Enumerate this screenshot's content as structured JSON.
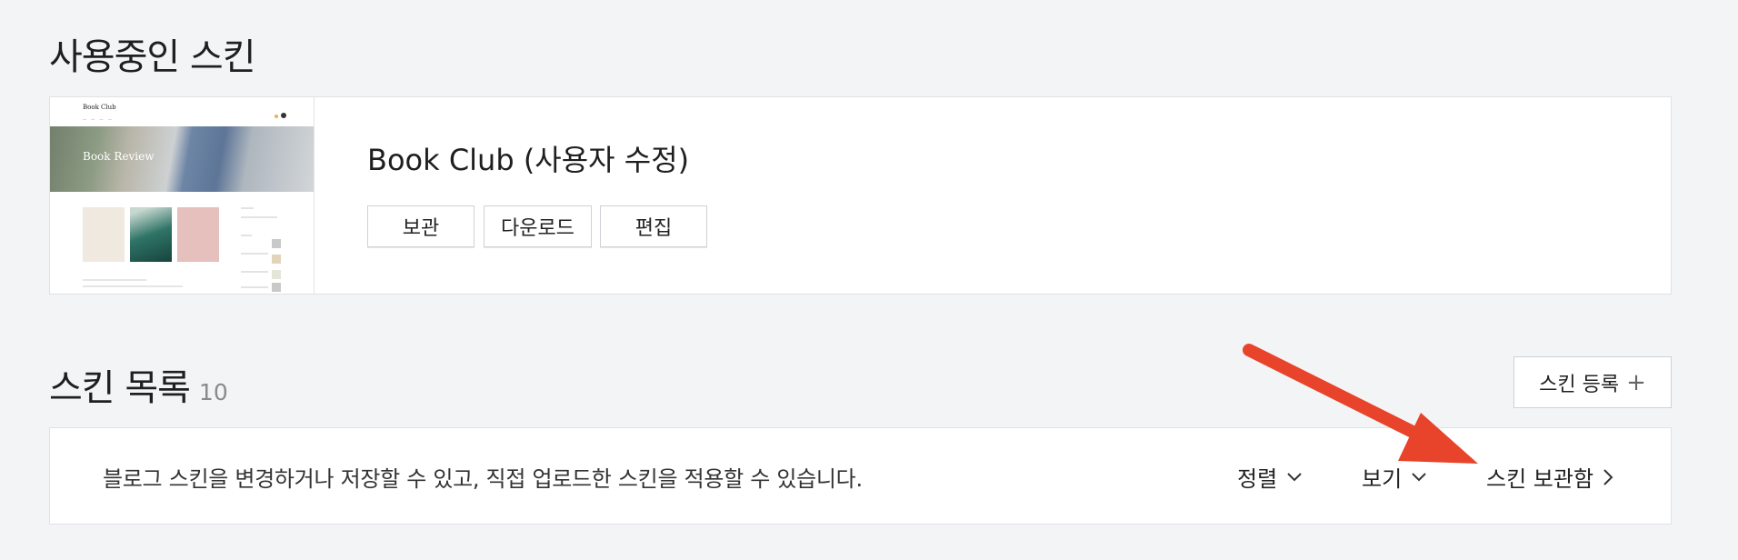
{
  "current_skin": {
    "section_title": "사용중인 스킨",
    "name": "Book Club (사용자 수정)",
    "buttons": {
      "archive": "보관",
      "download": "다운로드",
      "edit": "편집"
    },
    "thumbnail": {
      "site_title": "Book Club",
      "hero_text": "Book Review"
    }
  },
  "skin_list": {
    "section_title": "스킨 목록",
    "count": "10",
    "register_label": "스킨 등록",
    "register_icon": "plus-icon",
    "description": "블로그 스킨을 변경하거나 저장할 수 있고, 직접 업로드한 스킨을 적용할 수 있습니다.",
    "sort_label": "정렬",
    "view_label": "보기",
    "storage_label": "스킨 보관함"
  },
  "annotation": {
    "arrow_color": "#e8432b"
  }
}
